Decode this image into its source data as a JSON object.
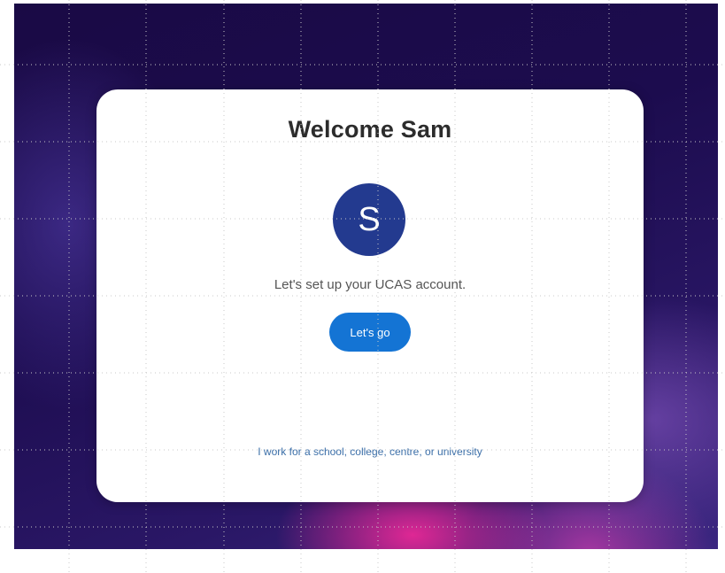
{
  "welcome": {
    "title": "Welcome Sam",
    "avatar_initial": "S",
    "message": "Let's set up your UCAS account.",
    "primary_button_label": "Let's go",
    "staff_link_label": "I work for a school, college, centre, or university"
  },
  "colors": {
    "avatar_background": "#233a8f",
    "button_background": "#1474d4",
    "link_color": "#3a6ea8",
    "page_background": "#1a0a45",
    "accent_glow": "#e82896"
  },
  "icons": {
    "avatar": "user-initial-avatar"
  }
}
